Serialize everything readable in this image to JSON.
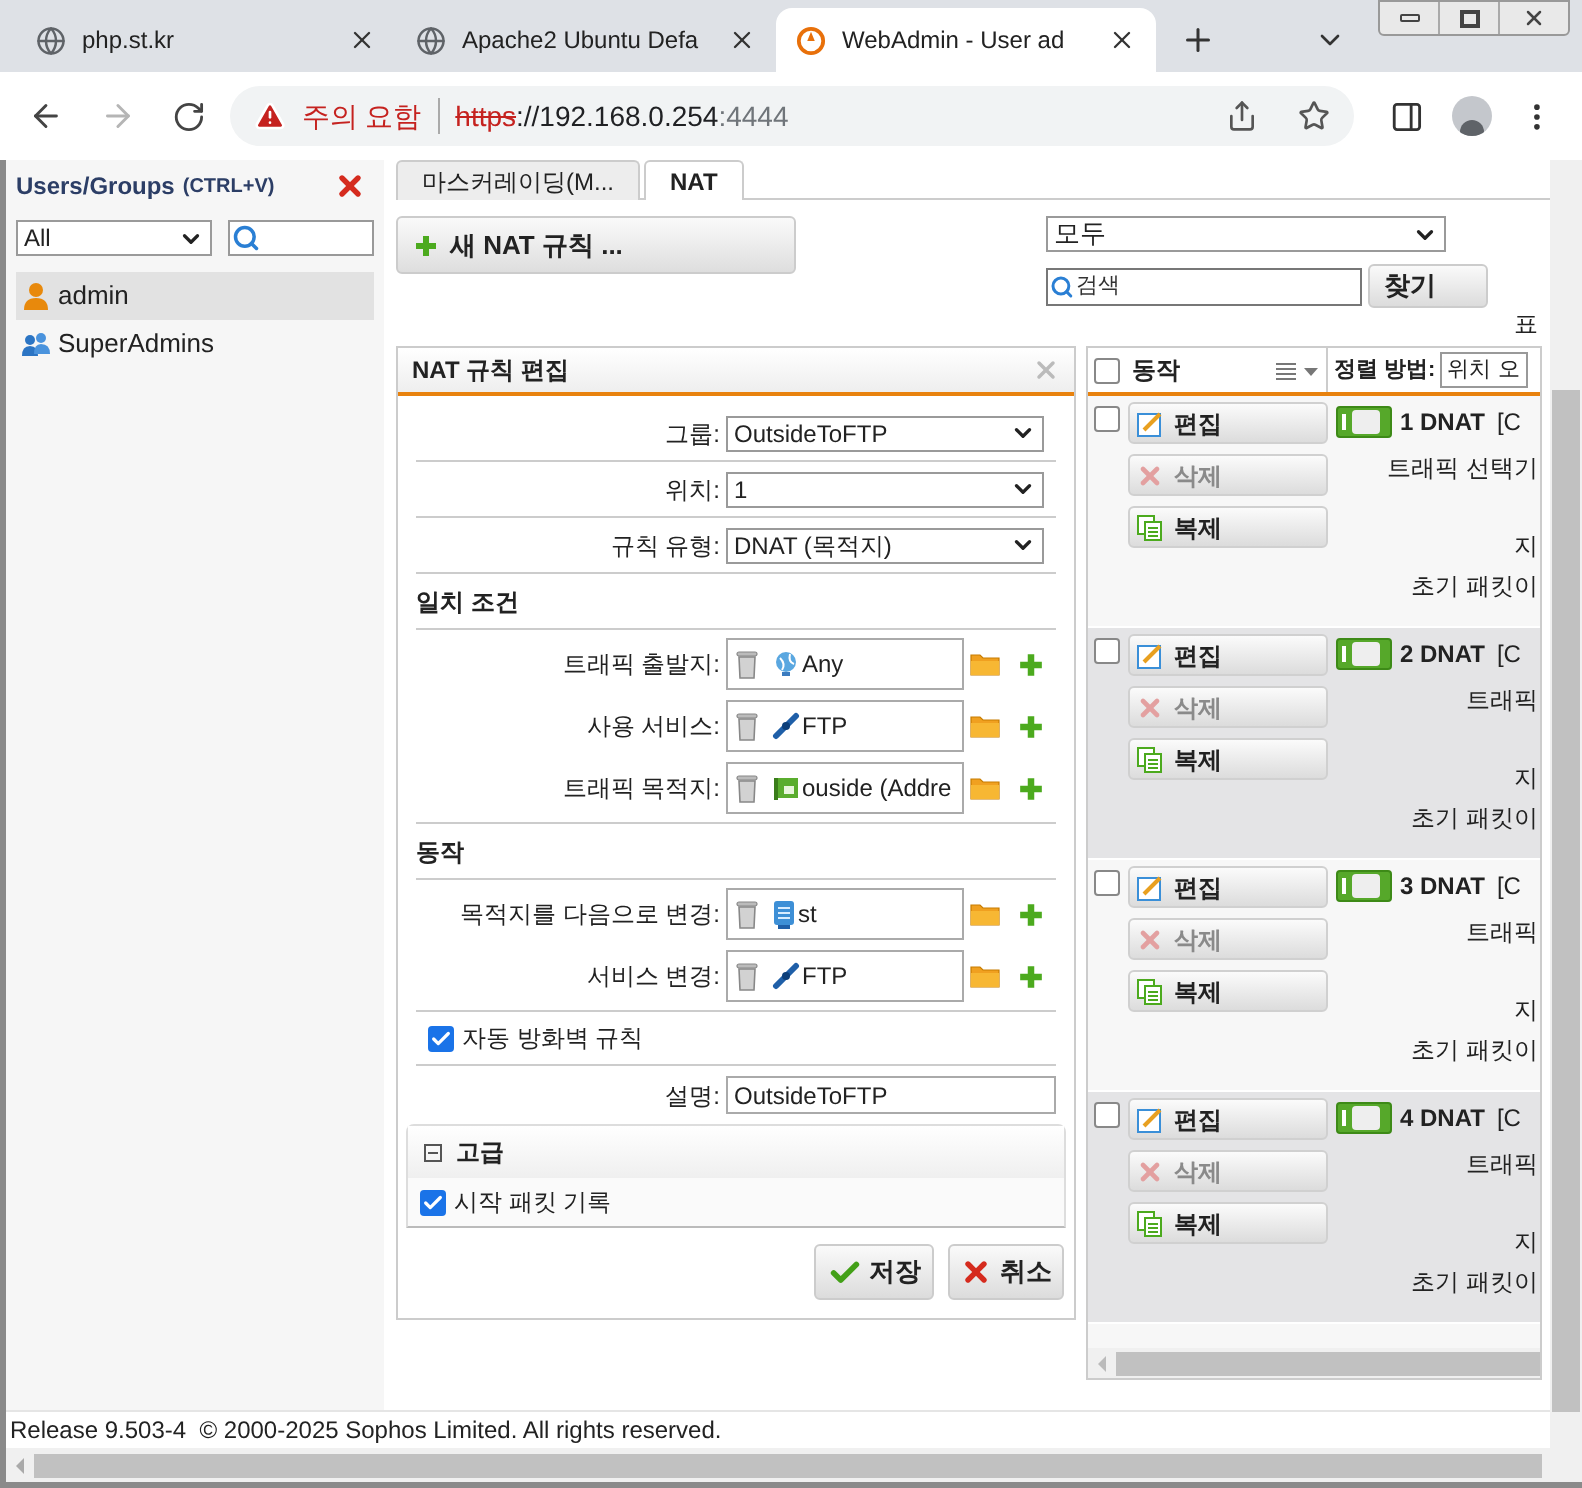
{
  "browser": {
    "tabs": [
      {
        "title": "php.st.kr",
        "kind": "site",
        "selected": false
      },
      {
        "title": "Apache2 Ubuntu Defa",
        "kind": "site",
        "selected": false
      },
      {
        "title": "WebAdmin - User ad",
        "kind": "webadmin",
        "selected": true
      }
    ],
    "security_warning": "주의 요함",
    "url_scheme": "https",
    "url_host": "://192.168.0.254",
    "url_port": ":4444"
  },
  "sidebar": {
    "title": "Users/Groups",
    "shortcut": "(CTRL+V)",
    "filter": "All",
    "items": [
      {
        "label": "admin",
        "kind": "user",
        "selected": true
      },
      {
        "label": "SuperAdmins",
        "kind": "group",
        "selected": false
      }
    ]
  },
  "tabs": [
    {
      "label": "마스커레이딩(M...",
      "selected": false
    },
    {
      "label": "NAT",
      "selected": true
    }
  ],
  "new_rule_button": "새 NAT 규칙 ...",
  "filter_select": "모두",
  "search": {
    "placeholder": "검색"
  },
  "find_button": "찾기",
  "cut_label": "표",
  "editor": {
    "title": "NAT 규칙 편집",
    "fields": [
      {
        "label": "그룹:",
        "value": "OutsideToFTP"
      },
      {
        "label": "위치:",
        "value": "1"
      },
      {
        "label": "규칙 유형:",
        "value": "DNAT (목적지)"
      }
    ],
    "sections": [
      {
        "title": "일치 조건",
        "objects": [
          {
            "label": "트래픽 출발지:",
            "value": "Any",
            "kind": "network"
          },
          {
            "label": "사용 서비스:",
            "value": "FTP",
            "kind": "service"
          },
          {
            "label": "트래픽 목적지:",
            "value": "ouside (Addre",
            "kind": "interface"
          }
        ]
      },
      {
        "title": "동작",
        "objects": [
          {
            "label": "목적지를 다음으로 변경:",
            "value": "st",
            "kind": "host"
          },
          {
            "label": "서비스 변경:",
            "value": "FTP",
            "kind": "service"
          }
        ]
      }
    ],
    "auto_firewall": {
      "label": "자동 방화벽 규칙",
      "checked": true
    },
    "description": {
      "label": "설명:",
      "value": "OutsideToFTP"
    },
    "advanced": {
      "title": "고급",
      "expanded": true,
      "log": {
        "label": "시작 패킷 기록",
        "checked": true
      }
    },
    "save": "저장",
    "cancel": "취소"
  },
  "rules": {
    "select_all": {
      "checked": false
    },
    "header_label": "동작",
    "sort_label": "정렬 방법:",
    "sort_value": "위치 오",
    "rows": [
      {
        "checked": false,
        "edit": "편집",
        "delete": "삭제",
        "delete_disabled": true,
        "clone": "복제",
        "on": true,
        "title": "1 DNAT",
        "tag": "[C",
        "line_1": "트래픽 선택기",
        "line_2": "지",
        "line_3": "초기 패킷이"
      },
      {
        "checked": false,
        "edit": "편집",
        "delete": "삭제",
        "delete_disabled": true,
        "clone": "복제",
        "on": true,
        "title": "2 DNAT",
        "tag": "[C",
        "line_1": "트래픽",
        "line_2": "지",
        "line_3": "초기 패킷이"
      },
      {
        "checked": false,
        "edit": "편집",
        "delete": "삭제",
        "delete_disabled": true,
        "clone": "복제",
        "on": true,
        "title": "3 DNAT",
        "tag": "[C",
        "line_1": "트래픽",
        "line_2": "지",
        "line_3": "초기 패킷이"
      },
      {
        "checked": false,
        "edit": "편집",
        "delete": "삭제",
        "delete_disabled": true,
        "clone": "복제",
        "on": true,
        "title": "4 DNAT",
        "tag": "[C",
        "line_1": "트래픽",
        "line_2": "지",
        "line_3": "초기 패킷이"
      }
    ]
  },
  "footer": "Release 9.503-4  © 2000-2025 Sophos Limited. All rights reserved."
}
